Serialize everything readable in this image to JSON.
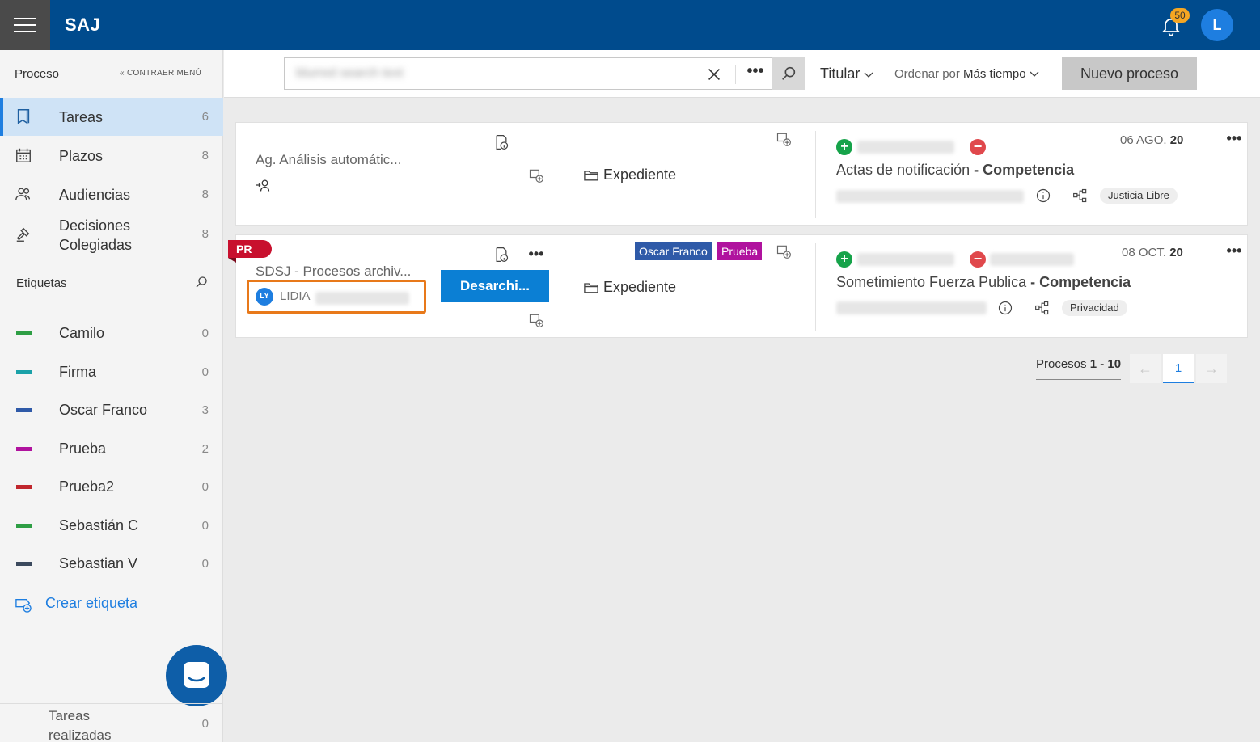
{
  "app": {
    "title": "SAJ",
    "notifications": "50",
    "user_initial": "L"
  },
  "sidebar": {
    "header": "Proceso",
    "collapse_label": "CONTRAER MENÚ",
    "items": [
      {
        "label": "Tareas",
        "count": "6",
        "icon": "bookmark-icon"
      },
      {
        "label": "Plazos",
        "count": "8",
        "icon": "calendar-icon"
      },
      {
        "label": "Audiencias",
        "count": "8",
        "icon": "people-icon"
      },
      {
        "label": "Decisiones Colegiadas",
        "count": "8",
        "icon": "gavel-icon"
      }
    ],
    "tags_header": "Etiquetas",
    "tags": [
      {
        "label": "Camilo",
        "count": "0",
        "color": "#2e9e44"
      },
      {
        "label": "Firma",
        "count": "0",
        "color": "#1aa1a8"
      },
      {
        "label": "Oscar Franco",
        "count": "3",
        "color": "#2f5aa8"
      },
      {
        "label": "Prueba",
        "count": "2",
        "color": "#b0129e"
      },
      {
        "label": "Prueba2",
        "count": "0",
        "color": "#c0262d"
      },
      {
        "label": "Sebastián C",
        "count": "0",
        "color": "#2e9e44"
      },
      {
        "label": "Sebastian V",
        "count": "0",
        "color": "#3c4a5e"
      }
    ],
    "create_tag": "Crear etiqueta",
    "footer": {
      "label": "Tareas realizadas",
      "count": "0"
    }
  },
  "toolbar": {
    "search_value": "blurred search text",
    "more": "•••",
    "titular": "Titular",
    "ordenar_prefix": "Ordenar por",
    "ordenar_value": "Más tiempo",
    "nuevo": "Nuevo proceso"
  },
  "cards": [
    {
      "title": "Ag. Análisis automátic...",
      "expediente": "Expediente",
      "date_prefix": "06 AGO.",
      "date_year": "20",
      "subject": "Actas de notificación",
      "subject_sep": "-",
      "subject_bold": "Competencia",
      "pill": "Justicia Libre"
    },
    {
      "badge": "PR",
      "title": "SDSJ - Procesos archiv...",
      "user_initials": "LY",
      "user_name": "LIDIA",
      "action": "Desarchi...",
      "expediente": "Expediente",
      "tags": [
        {
          "label": "Oscar Franco",
          "color": "#2f5aa8"
        },
        {
          "label": "Prueba",
          "color": "#b0129e"
        }
      ],
      "date_prefix": "08 OCT.",
      "date_year": "20",
      "subject": "Sometimiento Fuerza Publica",
      "subject_sep": "-",
      "subject_bold": "Competencia",
      "pill": "Privacidad"
    }
  ],
  "pagination": {
    "label_prefix": "Procesos",
    "range": "1 - 10",
    "current": "1",
    "prev": "←",
    "next": "→"
  }
}
